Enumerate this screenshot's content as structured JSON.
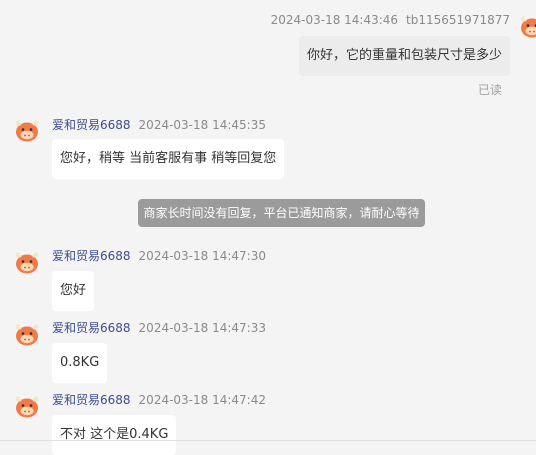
{
  "messages": [
    {
      "sender": "tb115651971877",
      "time": "2024-03-18 14:43:46",
      "text": "你好，它的重量和包装尺寸是多少",
      "status": "已读"
    },
    {
      "sender": "爱和贸易6688",
      "time": "2024-03-18 14:45:35",
      "text": "您好，稍等 当前客服有事 稍等回复您"
    },
    {
      "sender": "爱和贸易6688",
      "time": "2024-03-18 14:47:30",
      "text": "您好"
    },
    {
      "sender": "爱和贸易6688",
      "time": "2024-03-18 14:47:33",
      "text": "0.8KG"
    },
    {
      "sender": "爱和贸易6688",
      "time": "2024-03-18 14:47:42",
      "text": "不对 这个是0.4KG"
    }
  ],
  "system_notice": "商家长时间没有回复，平台已通知商家，请耐心等待",
  "colors": {
    "avatar": "#f07a4a",
    "name": "#3e4c8f",
    "notice_bg": "#9b9b9b"
  },
  "icons": {
    "avatar": "cow-avatar-icon"
  }
}
